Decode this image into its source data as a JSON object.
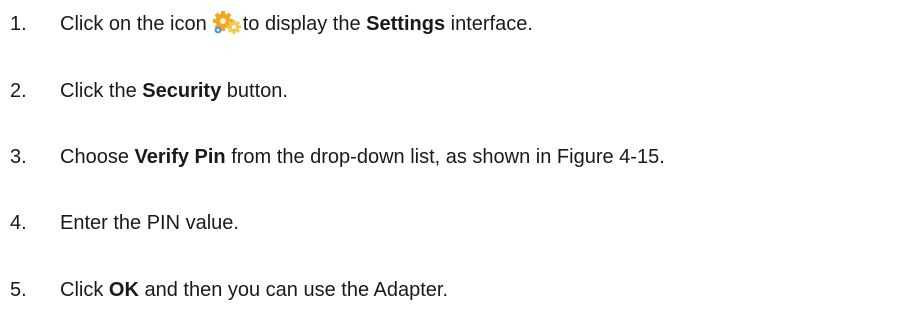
{
  "steps": [
    {
      "number": "1.",
      "part1": "Click on the icon",
      "icon": "settings-gears-icon",
      "part2": "to display the",
      "bold": "Settings",
      "part3": "interface."
    },
    {
      "number": "2.",
      "part1": "Click the",
      "bold": "Security",
      "part2": "button."
    },
    {
      "number": "3.",
      "part1": "Choose",
      "bold": "Verify Pin",
      "part2": "from the drop-down list, as shown in Figure 4-15."
    },
    {
      "number": "4.",
      "text": "Enter the PIN value."
    },
    {
      "number": "5.",
      "part1": "Click",
      "bold": "OK",
      "part2": "and then you can use the Adapter."
    }
  ],
  "colors": {
    "text": "#1a1a1a",
    "icon_gear_main": "#f2a623",
    "icon_gear_secondary": "#f6c94a",
    "icon_gear_blue": "#4f9bd9"
  }
}
